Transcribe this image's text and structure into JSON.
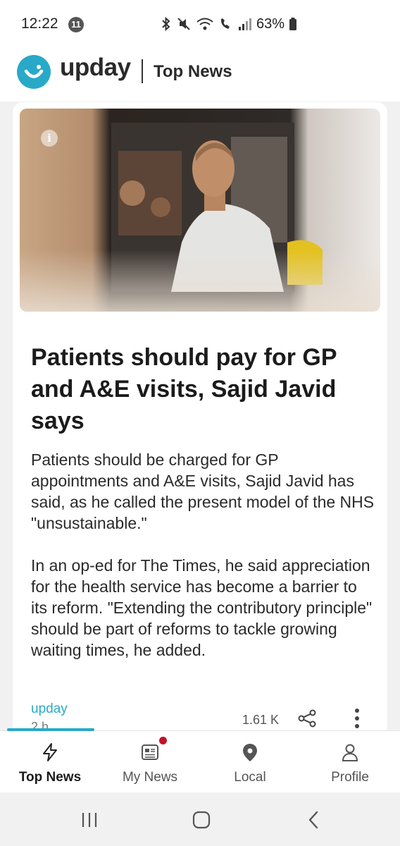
{
  "status_bar": {
    "time": "12:22",
    "notification_count": "11",
    "battery": "63%"
  },
  "header": {
    "app_name": "upday",
    "section": "Top News",
    "brand_color": "#29a9c8"
  },
  "article": {
    "headline": "Patients should pay for GP and A&E visits, Sajid Javid says",
    "paragraphs": [
      "Patients should be charged for GP appointments and A&E visits, Sajid Javid has said, as he called the present model of the NHS \"unsustainable.\"",
      "In an op-ed for The Times, he said appreciation for the health service has become a barrier to its reform. \"Extending the contributory principle\" should be part of reforms to tackle growing waiting times, he added."
    ],
    "source": "upday",
    "age": "2 h",
    "count": "1.61 K",
    "image_info_glyph": "i"
  },
  "bottom_nav": {
    "items": [
      {
        "label": "Top News",
        "icon": "bolt-icon",
        "active": true
      },
      {
        "label": "My News",
        "icon": "newspaper-icon",
        "active": false,
        "badge": true
      },
      {
        "label": "Local",
        "icon": "location-pin-icon",
        "active": false
      },
      {
        "label": "Profile",
        "icon": "person-icon",
        "active": false
      }
    ]
  },
  "system_nav": {
    "buttons": [
      "recent-apps",
      "home",
      "back"
    ]
  }
}
